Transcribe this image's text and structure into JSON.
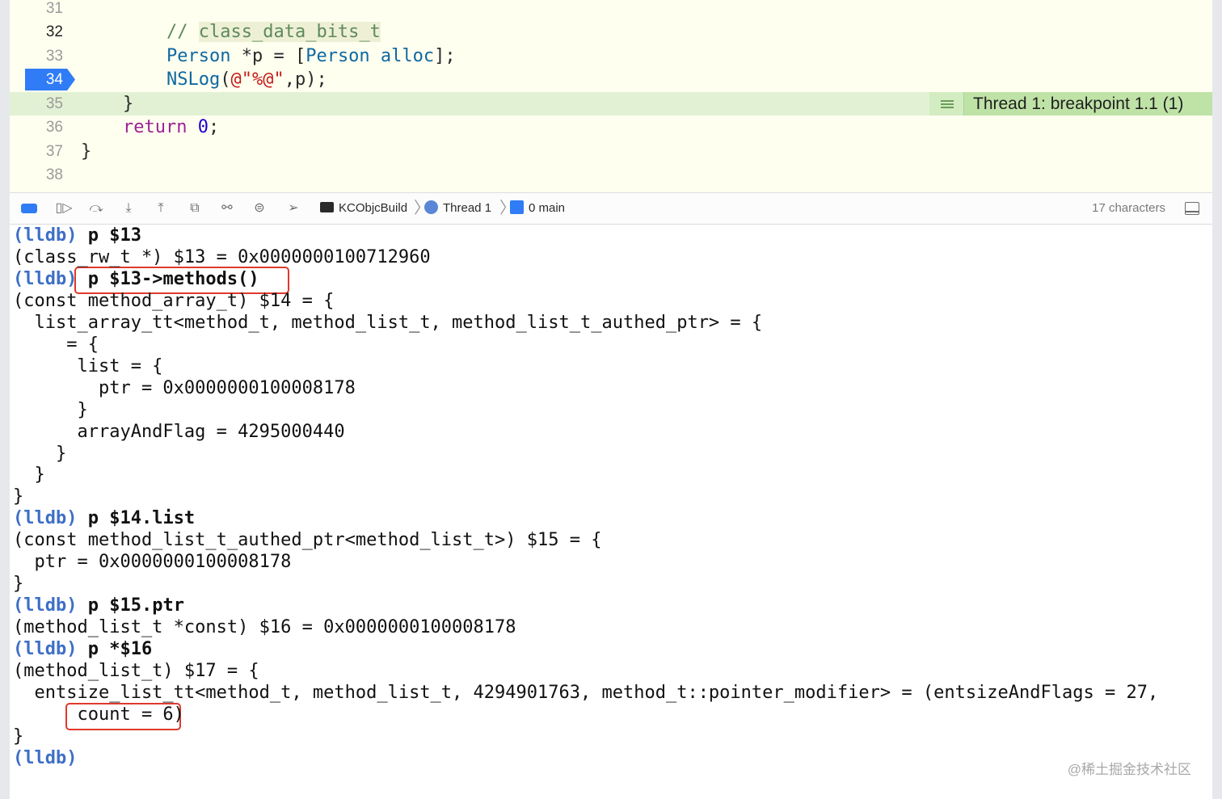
{
  "editor": {
    "lines": [
      {
        "num": "31",
        "parts": []
      },
      {
        "num": "32",
        "parts": [
          {
            "t": "// ",
            "c": "cm"
          },
          {
            "t": "class_data_bits_t",
            "c": "cm cmbg"
          }
        ]
      },
      {
        "num": "33",
        "parts": [
          {
            "t": "Person ",
            "c": "tp"
          },
          {
            "t": "*p = [",
            "c": ""
          },
          {
            "t": "Person ",
            "c": "tp"
          },
          {
            "t": "alloc",
            "c": "tp"
          },
          {
            "t": "];",
            "c": ""
          }
        ]
      },
      {
        "num": "34",
        "parts": [
          {
            "t": "NSLog",
            "c": "tp"
          },
          {
            "t": "(",
            "c": ""
          },
          {
            "t": "@\"%@\"",
            "c": "str"
          },
          {
            "t": ",p);",
            "c": ""
          }
        ]
      },
      {
        "num": "35",
        "parts": [
          {
            "t": "}",
            "c": ""
          }
        ]
      },
      {
        "num": "36",
        "parts": [
          {
            "t": "return ",
            "c": "kw"
          },
          {
            "t": "0",
            "c": "num"
          },
          {
            "t": ";",
            "c": ""
          }
        ]
      },
      {
        "num": "37",
        "parts": [
          {
            "t": "}",
            "c": ""
          }
        ]
      },
      {
        "num": "38",
        "parts": []
      }
    ],
    "breakpoint_line": "34",
    "thread_badge": "Thread 1: breakpoint 1.1 (1)"
  },
  "debug_bar": {
    "breadcrumb": [
      "KCObjcBuild",
      "Thread 1",
      "0 main"
    ],
    "char_count": "17 characters"
  },
  "console": {
    "prompt": "(lldb)",
    "lines": [
      {
        "prompt": true,
        "text": "p $13"
      },
      {
        "prompt": false,
        "text": "(class_rw_t *) $13 = 0x0000000100712960"
      },
      {
        "prompt": true,
        "text": "p $13->methods()"
      },
      {
        "prompt": false,
        "text": "(const method_array_t) $14 = {"
      },
      {
        "prompt": false,
        "text": "  list_array_tt<method_t, method_list_t, method_list_t_authed_ptr> = {"
      },
      {
        "prompt": false,
        "text": "     = {"
      },
      {
        "prompt": false,
        "text": "      list = {"
      },
      {
        "prompt": false,
        "text": "        ptr = 0x0000000100008178"
      },
      {
        "prompt": false,
        "text": "      }"
      },
      {
        "prompt": false,
        "text": "      arrayAndFlag = 4295000440"
      },
      {
        "prompt": false,
        "text": "    }"
      },
      {
        "prompt": false,
        "text": "  }"
      },
      {
        "prompt": false,
        "text": "}"
      },
      {
        "prompt": true,
        "text": "p $14.list"
      },
      {
        "prompt": false,
        "text": "(const method_list_t_authed_ptr<method_list_t>) $15 = {"
      },
      {
        "prompt": false,
        "text": "  ptr = 0x0000000100008178"
      },
      {
        "prompt": false,
        "text": "}"
      },
      {
        "prompt": true,
        "text": "p $15.ptr"
      },
      {
        "prompt": false,
        "text": "(method_list_t *const) $16 = 0x0000000100008178"
      },
      {
        "prompt": true,
        "text": "p *$16"
      },
      {
        "prompt": false,
        "text": "(method_list_t) $17 = {"
      },
      {
        "prompt": false,
        "text": "  entsize_list_tt<method_t, method_list_t, 4294901763, method_t::pointer_modifier> = (entsizeAndFlags = 27,"
      },
      {
        "prompt": false,
        "text": "      count = 6)"
      },
      {
        "prompt": false,
        "text": "}"
      },
      {
        "prompt": true,
        "text": ""
      }
    ]
  },
  "watermark": "@稀土掘金技术社区"
}
